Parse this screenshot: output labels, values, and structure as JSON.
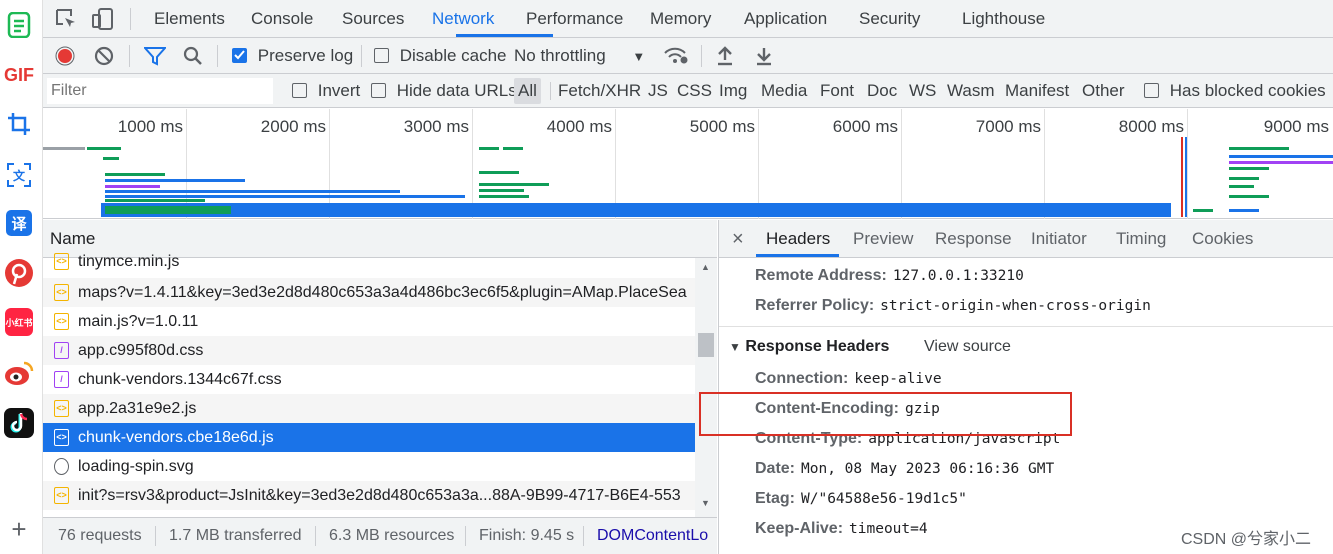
{
  "dock": {
    "gif_label": "GIF",
    "xhs_label": "小红书",
    "yi_label": "译"
  },
  "tabs": [
    {
      "label": "Elements"
    },
    {
      "label": "Console"
    },
    {
      "label": "Sources"
    },
    {
      "label": "Network"
    },
    {
      "label": "Performance"
    },
    {
      "label": "Memory"
    },
    {
      "label": "Application"
    },
    {
      "label": "Security"
    },
    {
      "label": "Lighthouse"
    }
  ],
  "toolbar": {
    "preserve_log": "Preserve log",
    "disable_cache": "Disable cache",
    "throttling": "No throttling"
  },
  "filterbar": {
    "filter_placeholder": "Filter",
    "invert": "Invert",
    "hide_data_urls": "Hide data URLs",
    "types": [
      "All",
      "Fetch/XHR",
      "JS",
      "CSS",
      "Img",
      "Media",
      "Font",
      "Doc",
      "WS",
      "Wasm",
      "Manifest",
      "Other"
    ],
    "has_blocked_cookies": "Has blocked cookies"
  },
  "timeline": {
    "ticks": [
      "1000 ms",
      "2000 ms",
      "3000 ms",
      "4000 ms",
      "5000 ms",
      "6000 ms",
      "7000 ms",
      "8000 ms",
      "9000 ms"
    ]
  },
  "requests": {
    "column_name": "Name",
    "rows": [
      {
        "name": "tinymce.min.js",
        "type": "js"
      },
      {
        "name": "maps?v=1.4.11&key=3ed3e2d8d480c653a3a4d486bc3ec6f5&plugin=AMap.PlaceSea",
        "type": "js"
      },
      {
        "name": "main.js?v=1.0.11",
        "type": "js"
      },
      {
        "name": "app.c995f80d.css",
        "type": "css"
      },
      {
        "name": "chunk-vendors.1344c67f.css",
        "type": "css"
      },
      {
        "name": "app.2a31e9e2.js",
        "type": "js"
      },
      {
        "name": "chunk-vendors.cbe18e6d.js",
        "type": "js",
        "selected": true
      },
      {
        "name": "loading-spin.svg",
        "type": "svg"
      },
      {
        "name": "init?s=rsv3&product=JsInit&key=3ed3e2d8d480c653a3a...88A-9B99-4717-B6E4-553",
        "type": "js"
      }
    ]
  },
  "status": {
    "requests": "76 requests",
    "transferred": "1.7 MB transferred",
    "resources": "6.3 MB resources",
    "finish": "Finish: 9.45 s",
    "domcontent": "DOMContentLo"
  },
  "details": {
    "tabs": [
      "Headers",
      "Preview",
      "Response",
      "Initiator",
      "Timing",
      "Cookies"
    ],
    "general": [
      {
        "key": "Remote Address:",
        "value": "127.0.0.1:33210"
      },
      {
        "key": "Referrer Policy:",
        "value": "strict-origin-when-cross-origin"
      }
    ],
    "response_section": "Response Headers",
    "view_source": "View source",
    "response_headers": [
      {
        "key": "Connection:",
        "value": "keep-alive"
      },
      {
        "key": "Content-Encoding:",
        "value": "gzip"
      },
      {
        "key": "Content-Type:",
        "value": "application/javascript"
      },
      {
        "key": "Date:",
        "value": "Mon, 08 May 2023 06:16:36 GMT"
      },
      {
        "key": "Etag:",
        "value": "W/\"64588e56-19d1c5\""
      },
      {
        "key": "Keep-Alive:",
        "value": "timeout=4"
      }
    ]
  },
  "watermark": "CSDN @兮家小二",
  "colors": {
    "accent": "#1a73e8",
    "highlight": "#d93025"
  }
}
